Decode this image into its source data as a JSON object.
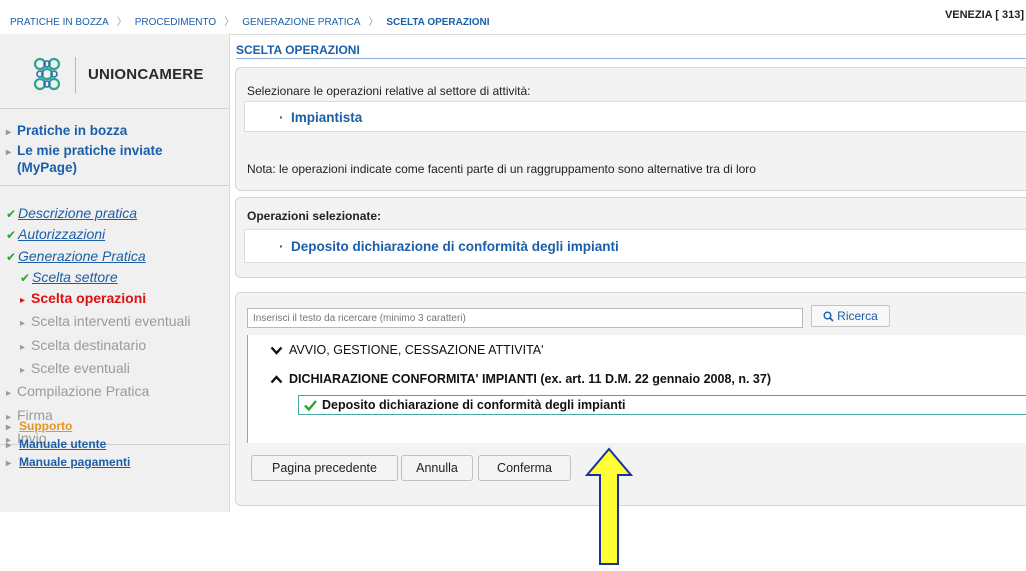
{
  "breadcrumb": {
    "items": [
      "PRATICHE IN BOZZA",
      "PROCEDIMENTO",
      "GENERAZIONE PRATICA",
      "SCELTA OPERAZIONI"
    ],
    "separator": "〉"
  },
  "header": {
    "location": "VENEZIA [ 313]"
  },
  "sidebar": {
    "brand": "UNIONCAMERE",
    "main_links": [
      "Pratiche in bozza",
      "Le mie pratiche inviate (MyPage)"
    ],
    "steps": {
      "descrizione": "Descrizione pratica",
      "autorizzazioni": "Autorizzazioni",
      "generazione": "Generazione Pratica",
      "scelta_settore": "Scelta settore",
      "scelta_operazioni": "Scelta operazioni",
      "scelta_interventi": "Scelta interventi eventuali",
      "scelta_destinatario": "Scelta destinatario",
      "scelte_eventuali": "Scelte eventuali",
      "compilazione": "Compilazione Pratica",
      "firma": "Firma",
      "invio": "Invio"
    },
    "support_links": [
      "Supporto",
      "Manuale utente",
      "Manuale pagamenti"
    ]
  },
  "main": {
    "section_title": "SCELTA OPERAZIONI",
    "intro": "Selezionare le operazioni relative al settore di attività:",
    "sector": "Impiantista",
    "note": "Nota: le operazioni indicate come facenti parte di un raggruppamento sono alternative tra di loro",
    "selected_label": "Operazioni selezionate:",
    "selected_item": "Deposito dichiarazione di conformità degli impianti",
    "search": {
      "placeholder": "Inserisci il testo da ricercare (minimo 3 caratteri)",
      "button": "Ricerca"
    },
    "tree": {
      "group1": "AVVIO, GESTIONE, CESSAZIONE ATTIVITA'",
      "group2": "DICHIARAZIONE CONFORMITA' IMPIANTI (ex. art. 11 D.M. 22 gennaio 2008, n. 37)",
      "leaf": "Deposito dichiarazione di conformità degli impianti"
    },
    "buttons": {
      "prev": "Pagina precedente",
      "cancel": "Annulla",
      "confirm": "Conferma"
    }
  },
  "colors": {
    "link_blue": "#1a5fa8",
    "current_step_red": "#e01010",
    "check_green": "#2aa52a",
    "support_orange": "#e8951a",
    "arrow_yellow": "#ffff33"
  },
  "icons": {
    "logo": "unioncamere-logo-icon",
    "check": "check-icon",
    "search": "search-icon",
    "caret_down": "chevron-down-icon",
    "caret_up": "chevron-up-icon",
    "annotation": "up-arrow-annotation-icon"
  }
}
